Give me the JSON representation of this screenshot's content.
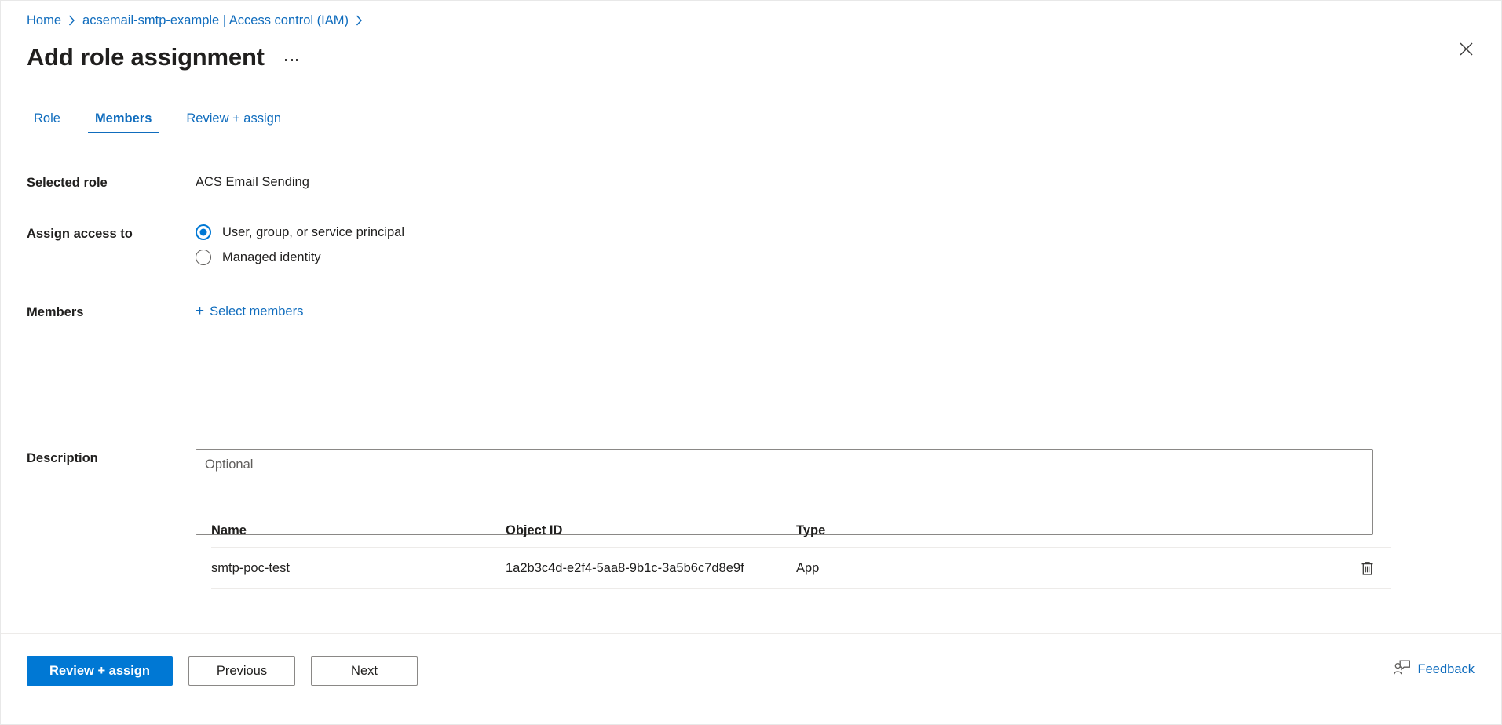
{
  "breadcrumb": {
    "items": [
      {
        "label": "Home"
      },
      {
        "label": "acsemail-smtp-example | Access control (IAM)"
      }
    ]
  },
  "header": {
    "title": "Add role assignment",
    "more_menu": "…",
    "close": "✕"
  },
  "tabs": [
    {
      "label": "Role",
      "active": false
    },
    {
      "label": "Members",
      "active": true
    },
    {
      "label": "Review + assign",
      "active": false
    }
  ],
  "form": {
    "selected_role": {
      "label": "Selected role",
      "value": "ACS Email Sending"
    },
    "assign_access_to": {
      "label": "Assign access to",
      "options": [
        {
          "label": "User, group, or service principal",
          "selected": true
        },
        {
          "label": "Managed identity",
          "selected": false
        }
      ]
    },
    "members": {
      "label": "Members",
      "select_members_label": "Select members",
      "plus_icon": "+"
    },
    "description": {
      "label": "Description",
      "placeholder": "Optional",
      "value": ""
    }
  },
  "members_table": {
    "columns": [
      "Name",
      "Object ID",
      "Type"
    ],
    "rows": [
      {
        "name": "smtp-poc-test",
        "object_id": "1a2b3c4d-e2f4-5aa8-9b1c-3a5b6c7d8e9f",
        "type": "App"
      }
    ]
  },
  "footer": {
    "primary_button": "Review + assign",
    "previous_button": "Previous",
    "next_button": "Next",
    "feedback_label": "Feedback"
  },
  "colors": {
    "accent": "#0078d4",
    "link": "#0f6cbd",
    "text": "#201f1e",
    "border": "#edebe9"
  }
}
